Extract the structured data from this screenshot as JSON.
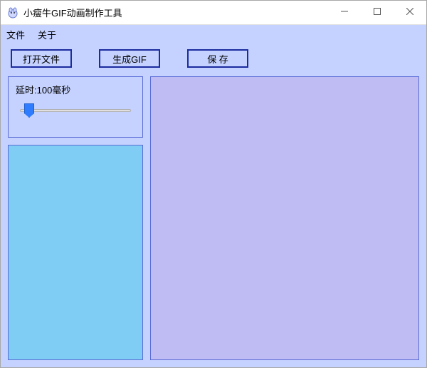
{
  "window": {
    "title": "小瘦牛GIF动画制作工具"
  },
  "menu": {
    "items": [
      "文件",
      "关于"
    ]
  },
  "toolbar": {
    "open_label": "打开文件",
    "generate_label": "生成GIF",
    "save_label": "保 存"
  },
  "delay": {
    "label_prefix": "延时:",
    "value": 100,
    "unit": "毫秒",
    "full_label": "延时:100毫秒"
  },
  "colors": {
    "client_bg": "#c5d2ff",
    "thumb_bg": "#7fcdf5",
    "preview_bg": "#bfbcf3",
    "button_border": "#1b2c9e"
  }
}
